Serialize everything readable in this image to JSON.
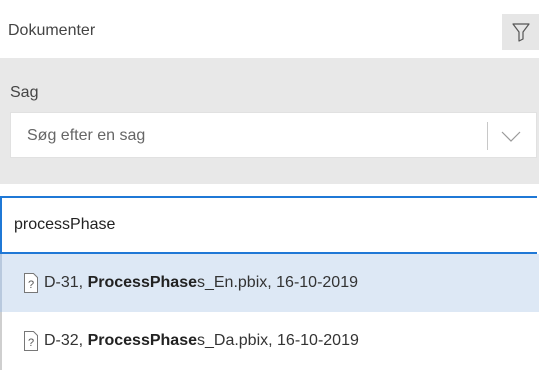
{
  "header": {
    "title": "Dokumenter",
    "filter_icon": "filter-icon"
  },
  "case_filter": {
    "label": "Sag",
    "placeholder": "Søg efter en sag",
    "dropdown_icon": "chevron-down-icon"
  },
  "search": {
    "value": "processPhase"
  },
  "results": [
    {
      "prefix": "D-31, ",
      "match": "ProcessPhase",
      "suffix": "s_En.pbix, 16-10-2019",
      "icon": "document-icon",
      "highlighted": true
    },
    {
      "prefix": "D-32, ",
      "match": "ProcessPhase",
      "suffix": "s_Da.pbix, 16-10-2019",
      "icon": "document-icon",
      "highlighted": false
    }
  ],
  "colors": {
    "accent": "#1f78d6",
    "highlight": "#dde8f5",
    "panel_bg": "#e8e8e8"
  }
}
